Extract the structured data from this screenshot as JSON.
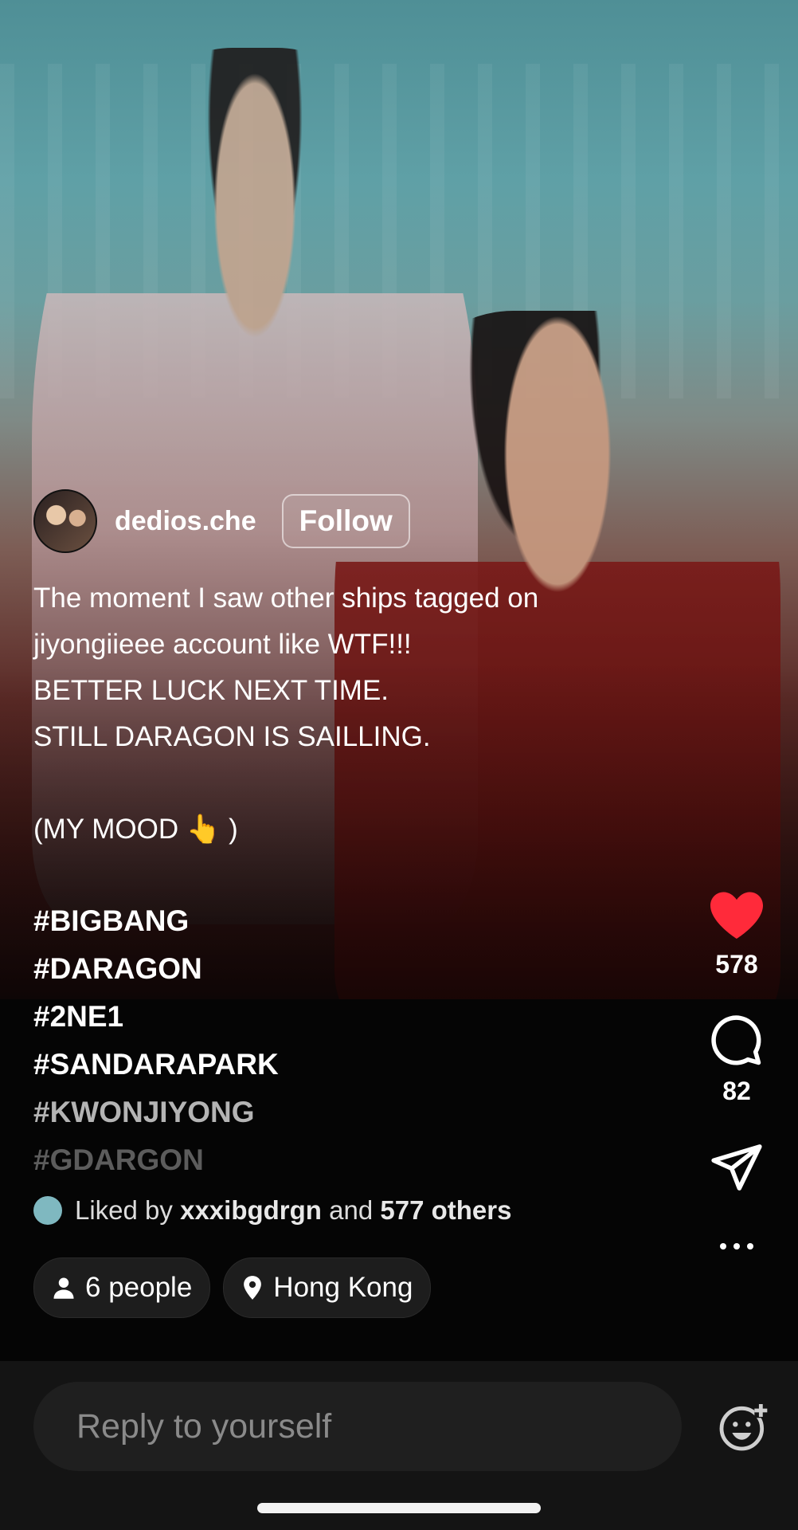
{
  "post": {
    "username": "dedios.che",
    "follow_label": "Follow",
    "caption_lines": [
      "The moment I saw other ships tagged on",
      "jiyongiieee account like WTF!!!",
      "BETTER LUCK NEXT TIME.",
      "STILL DARAGON IS SAILLING.",
      "",
      "(MY MOOD 👆 )"
    ],
    "hashtags": [
      "#BIGBANG",
      "#DARAGON",
      "#2NE1",
      "#SANDARAPARK",
      "#KWONJIYONG",
      "#GDARGON"
    ],
    "liked_by": {
      "prefix": "Liked by",
      "user": "xxxibgdrgn",
      "middle": "and",
      "others": "577 others"
    },
    "chips": {
      "people": "6 people",
      "location": "Hong Kong"
    }
  },
  "actions": {
    "like_count": "578",
    "comment_count": "82",
    "icons": [
      "heart-icon",
      "comment-icon",
      "share-icon",
      "more-icon"
    ],
    "like_color": "#ff2a3a"
  },
  "reply": {
    "placeholder": "Reply to yourself"
  }
}
